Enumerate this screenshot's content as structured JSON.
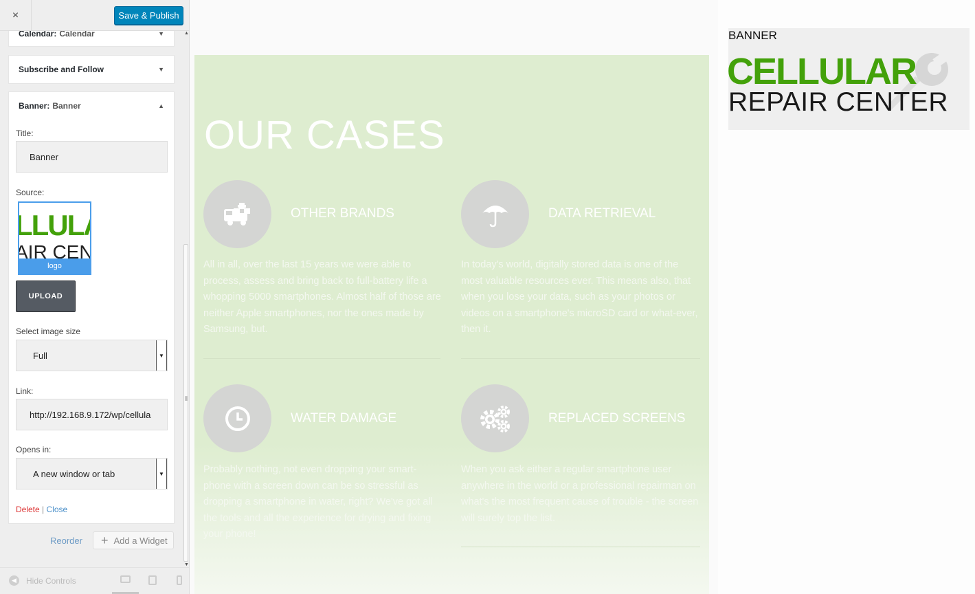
{
  "topbar": {
    "close_glyph": "×",
    "publish_label": "Save & Publish"
  },
  "widgets": {
    "calendar": {
      "prefix": "Calendar:",
      "title": "Calendar"
    },
    "subscribe": {
      "title": "Subscribe and Follow"
    },
    "banner": {
      "prefix": "Banner:",
      "title": "Banner"
    }
  },
  "form": {
    "title_label": "Title:",
    "title_value": "Banner",
    "source_label": "Source:",
    "thumb_line1": "LLULAR",
    "thumb_line2": "AIR CENT",
    "thumb_caption": "logo",
    "upload_label": "UPLOAD",
    "image_size_label": "Select image size",
    "image_size_value": "Full",
    "link_label": "Link:",
    "link_value": "http://192.168.9.172/wp/cellula",
    "opens_label": "Opens in:",
    "opens_value": "A new window or tab",
    "delete_label": "Delete",
    "separator": "|",
    "close_label": "Close"
  },
  "actions": {
    "reorder_label": "Reorder",
    "add_widget_label": "Add a Widget"
  },
  "footer": {
    "hide_controls_label": "Hide Controls"
  },
  "preview": {
    "section_title": "OUR CASES",
    "cases": [
      {
        "title": "OTHER BRANDS",
        "icon": "ambulance-icon",
        "text": "All in all, over the last 15 years we were able to process, assess and bring back to full-battery life a whopping 5000 smartphones. Almost half of those are neither Apple smartphones, nor the ones made by Samsung, but."
      },
      {
        "title": "DATA RETRIEVAL",
        "icon": "umbrella-icon",
        "text": "In today's world, digitally stored data is one of the most valuable resources ever. This means also, that when you lose your data, such as your photos or videos on a smartphone's microSD card or what-ever, then it."
      },
      {
        "title": "WATER DAMAGE",
        "icon": "clock-icon",
        "text": "Probably nothing, not even dropping your smart-phone with a screen down can be so stressful as dropping a smartphone in water, right? We've got all the tools and all the experience for drying and fixing your phone!"
      },
      {
        "title": "REPLACED SCREENS",
        "icon": "gears-icon",
        "text": "When you ask either a regular smartphone user anywhere in the world or a professional repairman on what's the most frequent cause of trouble - the screen will surely top the list."
      }
    ],
    "banner": {
      "title": "BANNER",
      "logo_line1": "CELLULAR",
      "logo_line2": "REPAIR CENTER"
    }
  },
  "colors": {
    "publish_blue": "#0085ba",
    "logo_green": "#43a10a",
    "cases_bg": "#deedd0",
    "delete_red": "#dc3232",
    "link_blue": "#4a8fc9"
  }
}
